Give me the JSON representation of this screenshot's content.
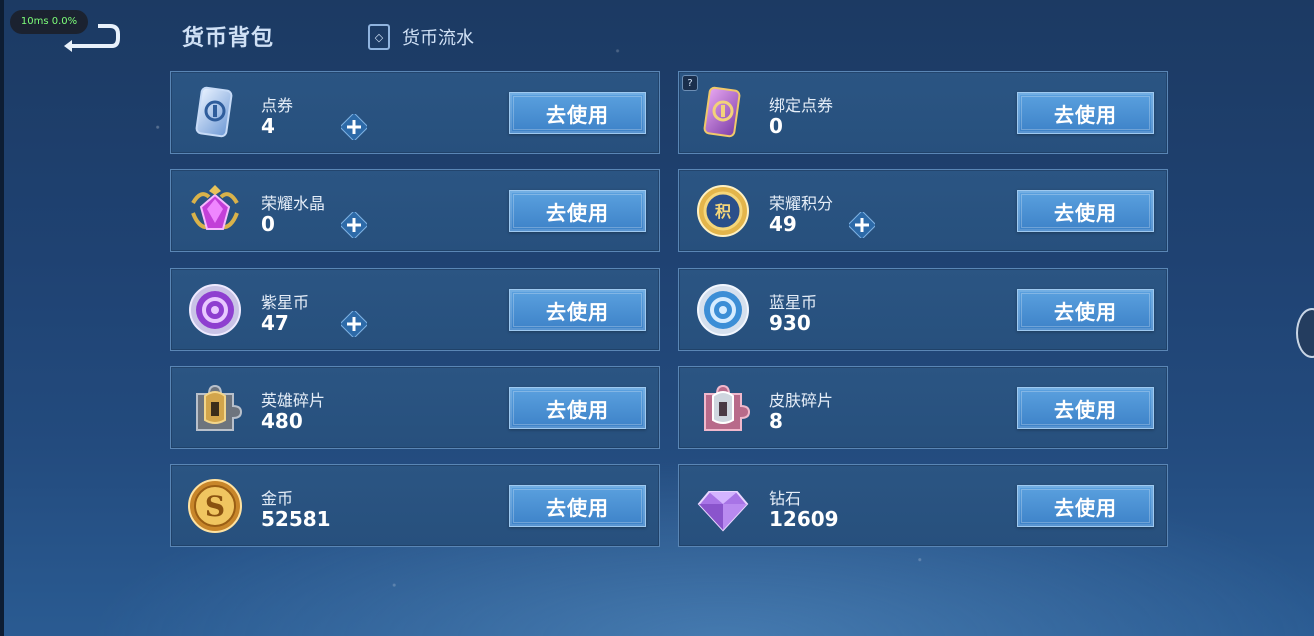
{
  "perf": {
    "label": "10ms  0.0%"
  },
  "header": {
    "title": "货币背包",
    "flow_link_label": "货币流水"
  },
  "use_label": "去使用",
  "currencies": [
    {
      "name": "点券",
      "value": "4",
      "icon": "voucher-card-icon",
      "has_plus": true
    },
    {
      "name": "绑定点券",
      "value": "0",
      "icon": "bound-voucher-card-icon",
      "has_plus": false,
      "help": "?"
    },
    {
      "name": "荣耀水晶",
      "value": "0",
      "icon": "glory-crystal-icon",
      "has_plus": true
    },
    {
      "name": "荣耀积分",
      "value": "49",
      "icon": "glory-points-icon",
      "has_plus": true
    },
    {
      "name": "紫星币",
      "value": "47",
      "icon": "purple-star-coin-icon",
      "has_plus": true
    },
    {
      "name": "蓝星币",
      "value": "930",
      "icon": "blue-star-coin-icon",
      "has_plus": false
    },
    {
      "name": "英雄碎片",
      "value": "480",
      "icon": "hero-fragment-icon",
      "has_plus": false
    },
    {
      "name": "皮肤碎片",
      "value": "8",
      "icon": "skin-fragment-icon",
      "has_plus": false
    },
    {
      "name": "金币",
      "value": "52581",
      "icon": "gold-coin-icon",
      "has_plus": false
    },
    {
      "name": "钻石",
      "value": "12609",
      "icon": "diamond-icon",
      "has_plus": false
    }
  ],
  "colors": {
    "background": "#1f4272",
    "card": "#2b5583",
    "button": "#4a90d2",
    "perf_text": "#7dff7a"
  }
}
